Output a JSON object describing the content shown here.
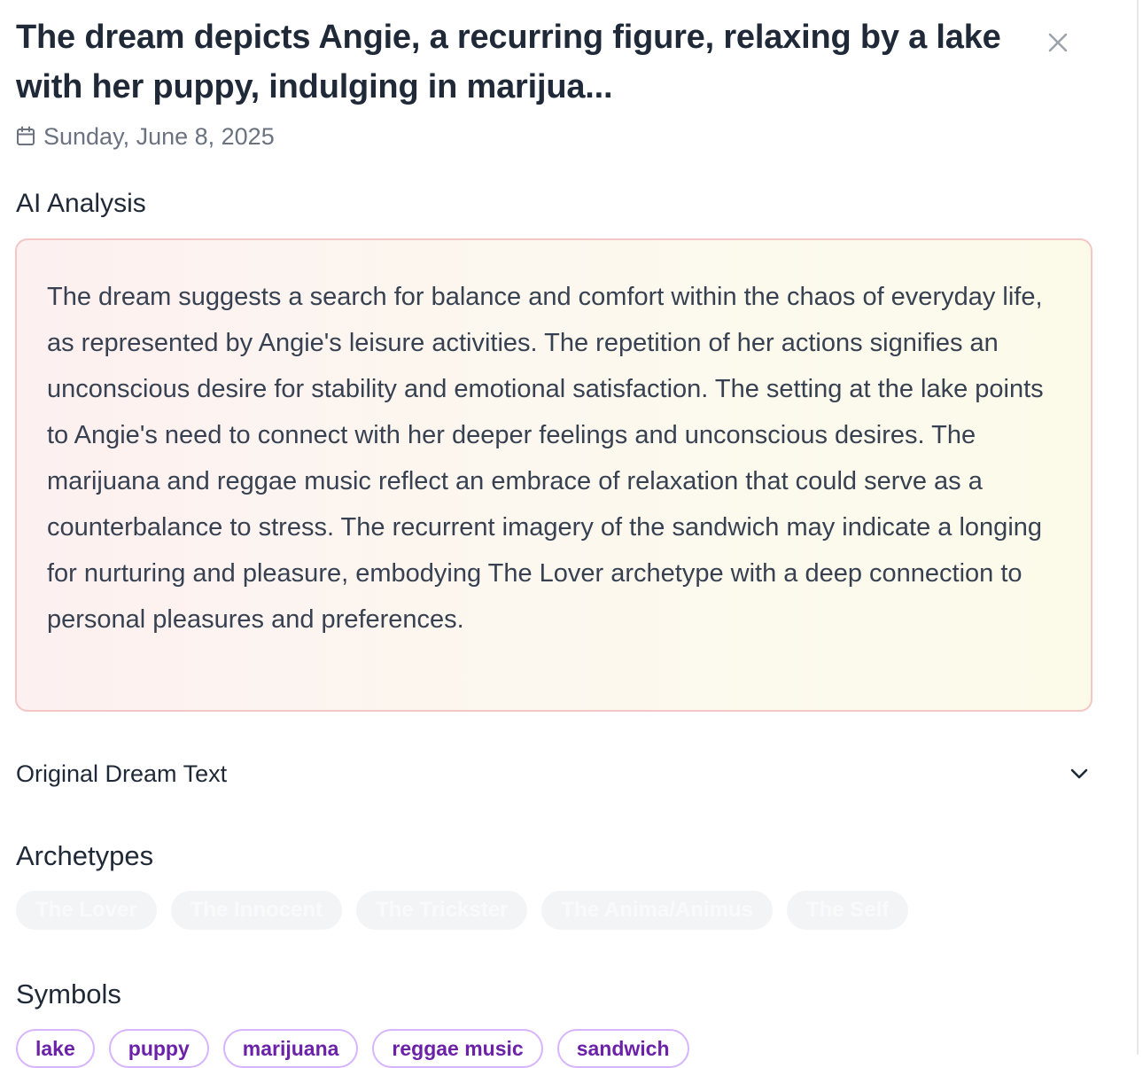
{
  "header": {
    "title": "The dream depicts Angie, a recurring figure, relaxing by a lake with her puppy, indulging in marijua...",
    "date": "Sunday, June 8, 2025",
    "close_icon": "close-icon",
    "date_icon": "calendar-icon"
  },
  "analysis": {
    "label": "AI Analysis",
    "text": "The dream suggests a search for balance and comfort within the chaos of everyday life, as represented by Angie's leisure activities. The repetition of her actions signifies an unconscious desire for stability and emotional satisfaction. The setting at the lake points to Angie's need to connect with her deeper feelings and unconscious desires. The marijuana and reggae music reflect an embrace of relaxation that could serve as a counterbalance to stress. The recurrent imagery of the sandwich may indicate a longing for nurturing and pleasure, embodying The Lover archetype with a deep connection to personal pleasures and preferences."
  },
  "original_dream": {
    "label": "Original Dream Text",
    "toggle_icon": "chevron-down-icon"
  },
  "archetypes": {
    "label": "Archetypes",
    "items": [
      "The Lover",
      "The Innocent",
      "The Trickster",
      "The Anima/Animus",
      "The Self"
    ]
  },
  "symbols": {
    "label": "Symbols",
    "items": [
      "lake",
      "puppy",
      "marijuana",
      "reggae music",
      "sandwich"
    ]
  },
  "colors": {
    "symbol_chip_border": "#d8b4fe",
    "symbol_chip_text": "#6b21a8",
    "analysis_border": "#f5c6c6"
  }
}
